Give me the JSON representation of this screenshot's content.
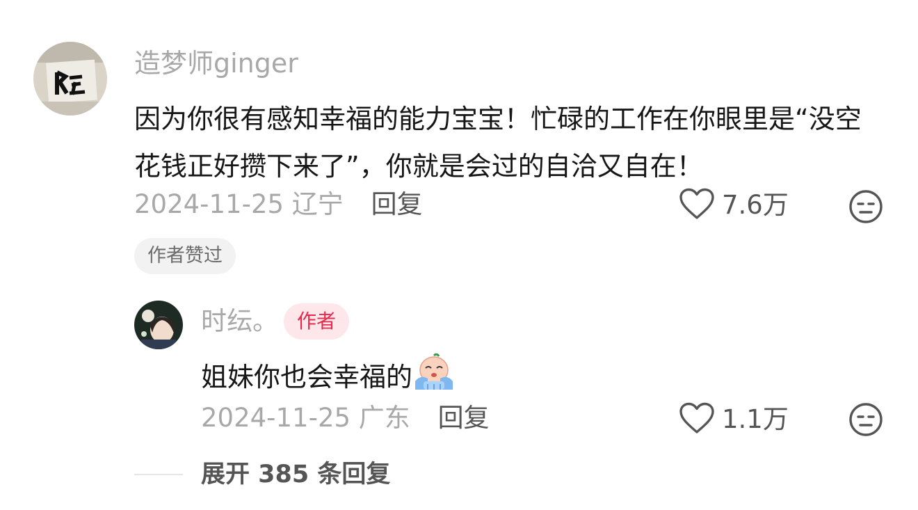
{
  "comment": {
    "username": "造梦师ginger",
    "text": "因为你很有感知幸福的能力宝宝！忙碌的工作在你眼里是“没空花钱正好攒下来了”，你就是会过的自洽又自在！",
    "date": "2024-11-25",
    "location": "辽宁",
    "reply_label": "回复",
    "like_count": "7.6万",
    "author_liked_label": "作者赞过"
  },
  "reply": {
    "username": "时纭。",
    "author_badge": "作者",
    "text": "姐妹你也会幸福的",
    "date": "2024-11-25",
    "location": "广东",
    "reply_label": "回复",
    "like_count": "1.1万"
  },
  "expand": {
    "label": "展开 385 条回复"
  },
  "colors": {
    "text_primary": "#161616",
    "text_secondary": "#a8a8a8",
    "text_action": "#555555",
    "badge_bg": "#fde7ea",
    "badge_text": "#e8294c",
    "chip_bg": "#f2f2f2"
  },
  "icons": [
    "heart-icon",
    "dislike-face-icon",
    "crying-emoji"
  ]
}
